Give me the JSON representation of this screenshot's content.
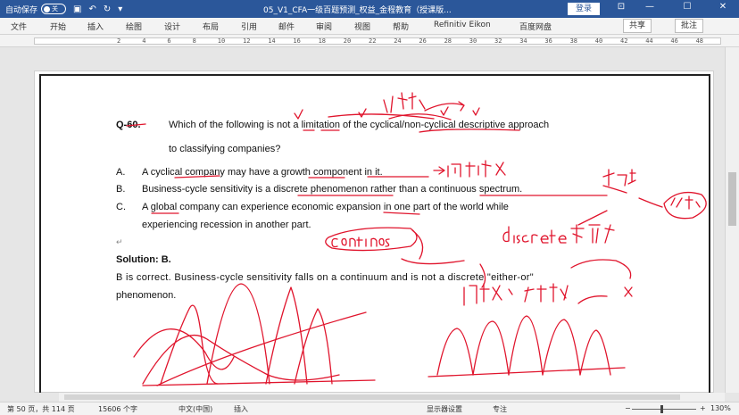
{
  "titlebar": {
    "autosave_label": "自动保存",
    "autosave_state": "关",
    "doc_title": "05_V1_CFA一级百题预测_权益_金程教育（授课版...",
    "login_label": "登录",
    "undo_glyph": "↶",
    "redo_glyph": "↻",
    "save_glyph": "▣",
    "qa_more_glyph": "▾",
    "ctrl": {
      "ribbon_display": "⊡",
      "minimize": "—",
      "maximize": "☐",
      "close": "✕"
    }
  },
  "ribbon": {
    "tabs": [
      "文件",
      "开始",
      "插入",
      "绘图",
      "设计",
      "布局",
      "引用",
      "邮件",
      "审阅",
      "视图",
      "帮助",
      "Refinitiv Eikon",
      "百度网盘"
    ],
    "share_label": "共享",
    "comment_label": "批注"
  },
  "ruler": {
    "numbers": [
      "2",
      "4",
      "6",
      "8",
      "10",
      "12",
      "14",
      "16",
      "18",
      "20",
      "22",
      "24",
      "26",
      "28",
      "30",
      "32",
      "34",
      "36",
      "38",
      "40",
      "42",
      "44",
      "46",
      "48"
    ]
  },
  "document": {
    "question_number": "Q-60.",
    "question_line1": "Which of the following is not a limitation of the cyclical/non-cyclical descriptive approach",
    "question_line2": "to classifying companies?",
    "options": [
      {
        "letter": "A.",
        "text": "A cyclical company may have a growth component in it."
      },
      {
        "letter": "B.",
        "text": "Business-cycle sensitivity is a discrete phenomenon rather than a continuous spectrum."
      },
      {
        "letter": "C.",
        "text": "A global company can experience economic expansion in one part of the world while"
      }
    ],
    "option_c_line2": "experiencing recession in another part.",
    "solution_label": "Solution: B.",
    "explanation_line1": "B is correct. Business-cycle sensitivity falls on a continuum and is not a discrete \"either-or\"",
    "explanation_line2": "phenomenon.",
    "paragraph_mark": "↵"
  },
  "annotations": {
    "ink_color": "#e0142c",
    "handwriting": [
      "缺点",
      "⇒周期成长",
      "缺了",
      "缺点",
      "Continous",
      "discrete 离散",
      "长期点 分类的",
      "X"
    ]
  },
  "statusbar": {
    "page": "第 50 页，共 114 页",
    "words": "15606 个字",
    "language": "中文(中国)",
    "mode": "插入",
    "display_settings": "显示器设置",
    "focus": "专注",
    "zoom": "130%",
    "zoom_minus": "−",
    "zoom_plus": "+"
  }
}
